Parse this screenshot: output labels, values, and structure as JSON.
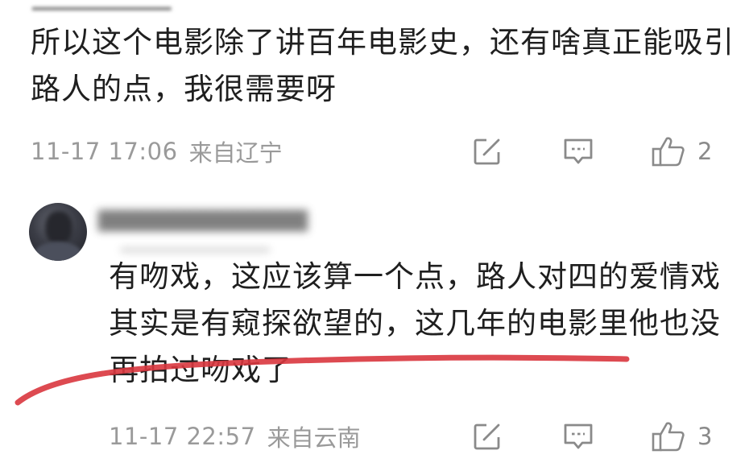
{
  "comments": [
    {
      "username": "",
      "text": "所以这个电影除了讲百年电影史，还有啥真正能吸引路人的点，我很需要呀",
      "time": "11-17 17:06",
      "location": "来自辽宁",
      "likes": "2"
    },
    {
      "username": "",
      "text": "有吻戏，这应该算一个点，路人对四的爱情戏其实是有窥探欲望的，这几年的电影里他也没再拍过吻戏了",
      "time": "11-17 22:57",
      "location": "来自云南",
      "likes": "3"
    }
  ],
  "icons": {
    "share": "share-edit-icon",
    "reply": "comment-reply-icon",
    "like": "thumbs-up-icon"
  },
  "colors": {
    "text": "#1f1f1f",
    "meta": "#9a9a9a",
    "annotation": "#d9363e"
  }
}
